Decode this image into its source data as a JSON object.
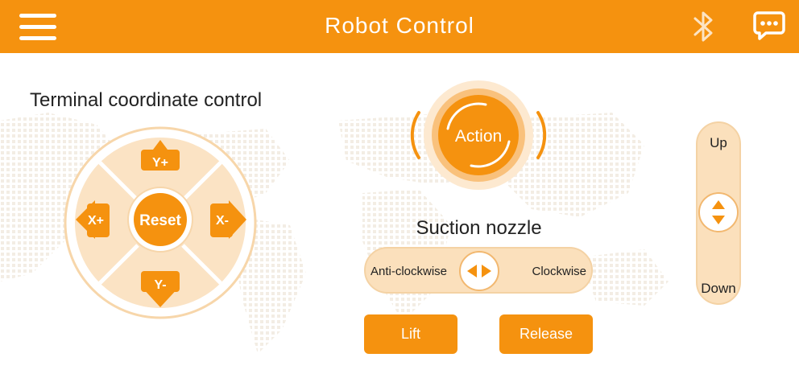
{
  "header": {
    "title": "Robot Control",
    "menu_icon": "hamburger-menu-icon",
    "bluetooth_icon": "bluetooth-icon",
    "message_icon": "chat-bubble-icon"
  },
  "terminal": {
    "label": "Terminal coordinate control",
    "y_plus": "Y+",
    "y_minus": "Y-",
    "x_plus": "X+",
    "x_minus": "X-",
    "reset": "Reset"
  },
  "action": {
    "label": "Action"
  },
  "suction": {
    "label": "Suction nozzle",
    "anticlockwise": "Anti-clockwise",
    "clockwise": "Clockwise"
  },
  "buttons": {
    "lift": "Lift",
    "release": "Release"
  },
  "vertical": {
    "up": "Up",
    "down": "Down"
  },
  "colors": {
    "accent": "#f5920f",
    "light_accent": "#fbe0bc",
    "border_accent": "#f2b870"
  }
}
